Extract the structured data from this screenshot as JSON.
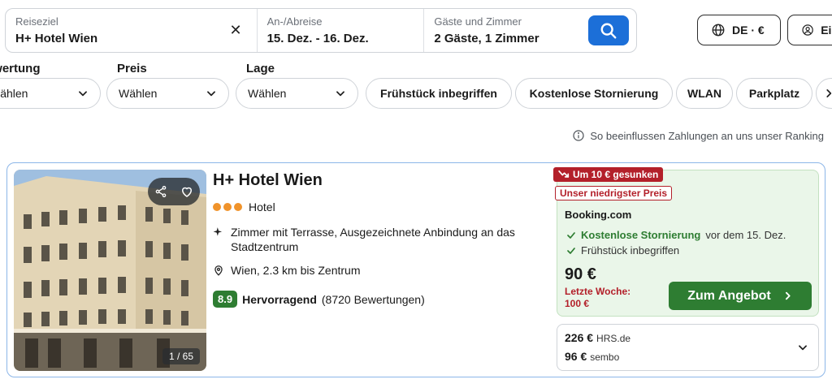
{
  "search": {
    "destination_label": "Reiseziel",
    "destination_value": "H+ Hotel Wien",
    "dates_label": "An-/Abreise",
    "dates_value": "15. Dez. - 16. Dez.",
    "guests_label": "Gäste und Zimmer",
    "guests_value": "2 Gäste, 1 Zimmer",
    "clear_icon": "✕"
  },
  "header": {
    "language_label": "DE · €",
    "login_label": "Ein"
  },
  "filters": {
    "rating_label": "Bewertung",
    "rating_value": "Wählen",
    "price_label": "Preis",
    "price_value": "Wählen",
    "location_label": "Lage",
    "location_value": "Wählen",
    "chips": [
      "Frühstück inbegriffen",
      "Kostenlose Stornierung",
      "WLAN",
      "Parkplatz"
    ]
  },
  "ranking_note": "So beeinflussen Zahlungen an uns unser Ranking",
  "hotel": {
    "name": "H+ Hotel Wien",
    "type": "Hotel",
    "stars": 3,
    "features": "Zimmer mit Terrasse, Ausgezeichnete Anbindung an das Stadtzentrum",
    "location": "Wien, 2.3 km bis Zentrum",
    "score": "8.9",
    "rating_word": "Hervorragend",
    "review_count": "(8720 Bewertungen)",
    "photo_counter": "1 / 65"
  },
  "offer": {
    "price_drop_badge": "Um 10 € gesunken",
    "lowest_badge": "Unser niedrigster Preis",
    "provider": "Booking.com",
    "perk1_bold": "Kostenlose Stornierung",
    "perk1_rest": "vor dem 15. Dez.",
    "perk2": "Frühstück inbegriffen",
    "price": "90 €",
    "last_week_label": "Letzte Woche:",
    "last_week_price": "100 €",
    "cta": "Zum Angebot"
  },
  "alternatives": [
    {
      "price": "226 €",
      "provider": "HRS.de"
    },
    {
      "price": "96 €",
      "provider": "sembo"
    }
  ],
  "colors": {
    "primary_blue": "#1c6fd8",
    "deal_green": "#2e7d32",
    "offer_bg": "#eaf6e9",
    "badge_red": "#b3202a",
    "star_orange": "#f0932b",
    "card_border": "#8cb6e8"
  }
}
